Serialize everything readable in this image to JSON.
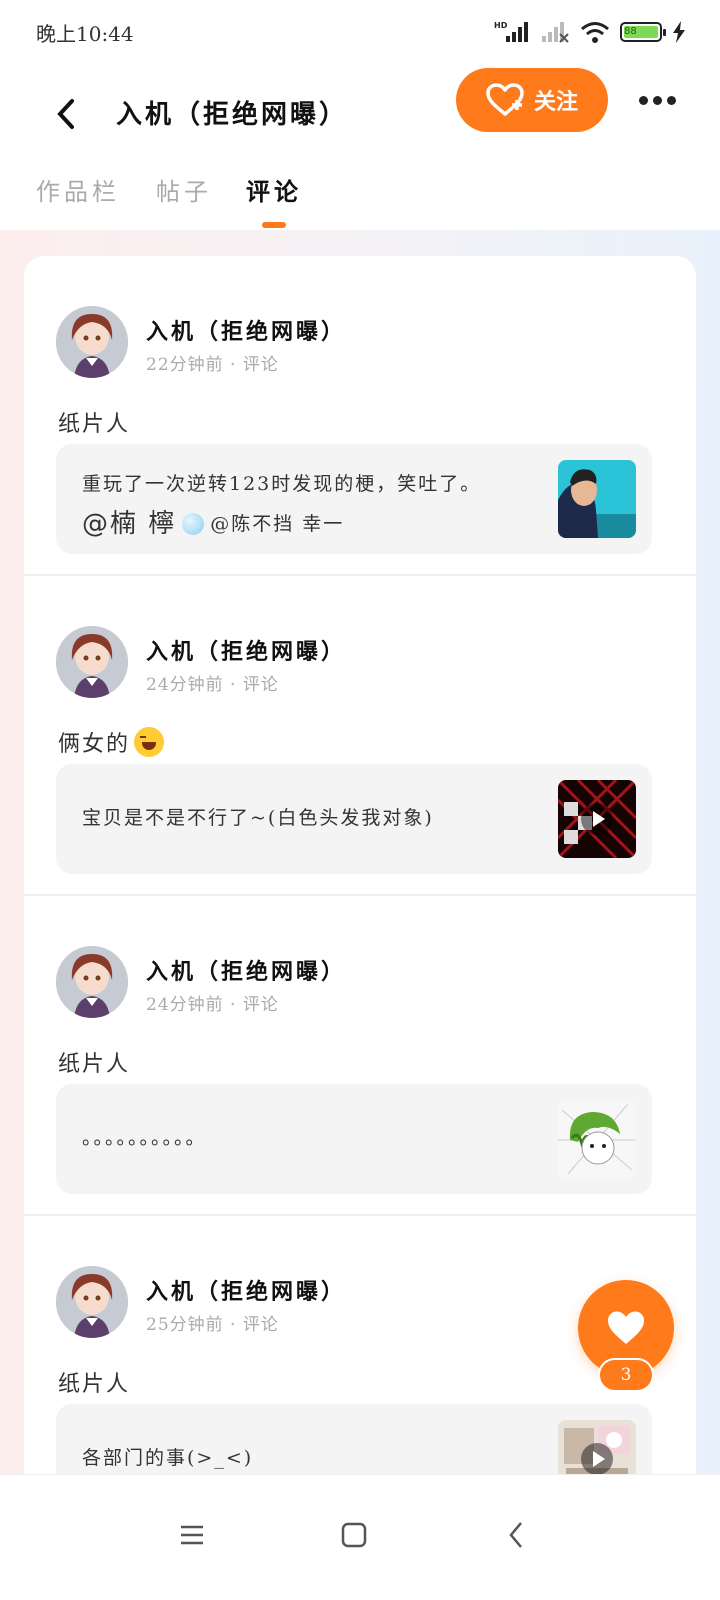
{
  "status_bar": {
    "time": "晚上10:44",
    "battery": "88"
  },
  "header": {
    "title": "入机（拒绝网曝）",
    "follow_label": "关注"
  },
  "tabs": [
    {
      "label": "作品栏",
      "active": false
    },
    {
      "label": "帖子",
      "active": false
    },
    {
      "label": "评论",
      "active": true
    }
  ],
  "comments": [
    {
      "author": "入机（拒绝网曝）",
      "meta": "22分钟前 · 评论",
      "text": "纸片人",
      "quote_line1": "重玩了一次逆转123时发现的梗，笑吐了。",
      "quote_mention1": "@楠 檸",
      "quote_mention2": "@陈不挡 幸一"
    },
    {
      "author": "入机（拒绝网曝）",
      "meta": "24分钟前 · 评论",
      "text": "俩女的",
      "quote_line1": "宝贝是不是不行了~(白色头发我对象)"
    },
    {
      "author": "入机（拒绝网曝）",
      "meta": "24分钟前 · 评论",
      "text": "纸片人",
      "quote_line1": "。。。。。。。。。。"
    },
    {
      "author": "入机（拒绝网曝）",
      "meta": "25分钟前 · 评论",
      "text": "纸片人",
      "quote_line1": "各部门的事(>_<)"
    }
  ],
  "floating_like": {
    "count": "3"
  },
  "colors": {
    "accent": "#ff7a1a",
    "quote_bg": "#f4f4f4"
  }
}
